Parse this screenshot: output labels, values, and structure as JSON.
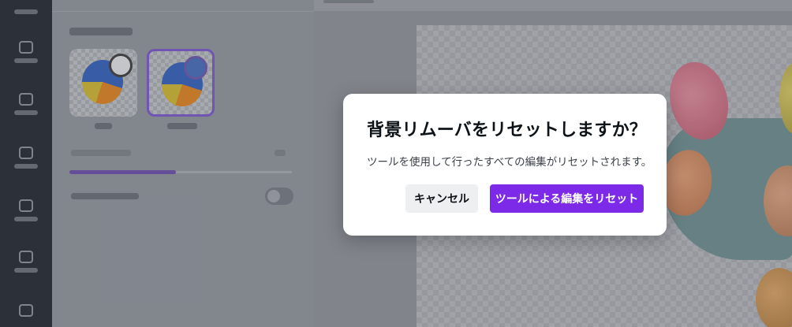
{
  "dialog": {
    "title": "背景リムーバをリセットしますか？",
    "message": "ツールを使用して行ったすべての編集がリセットされます。",
    "cancel_label": "キャンセル",
    "confirm_label": "ツールによる編集をリセット"
  },
  "background": {
    "brush_size_slider_level": 0.48,
    "restore_toggle_on": false
  },
  "colors": {
    "accent": "#7d2ae8",
    "dialog_bg": "#ffffff",
    "cancel_bg": "#eeeff1",
    "sidebar": "#2d323a"
  }
}
